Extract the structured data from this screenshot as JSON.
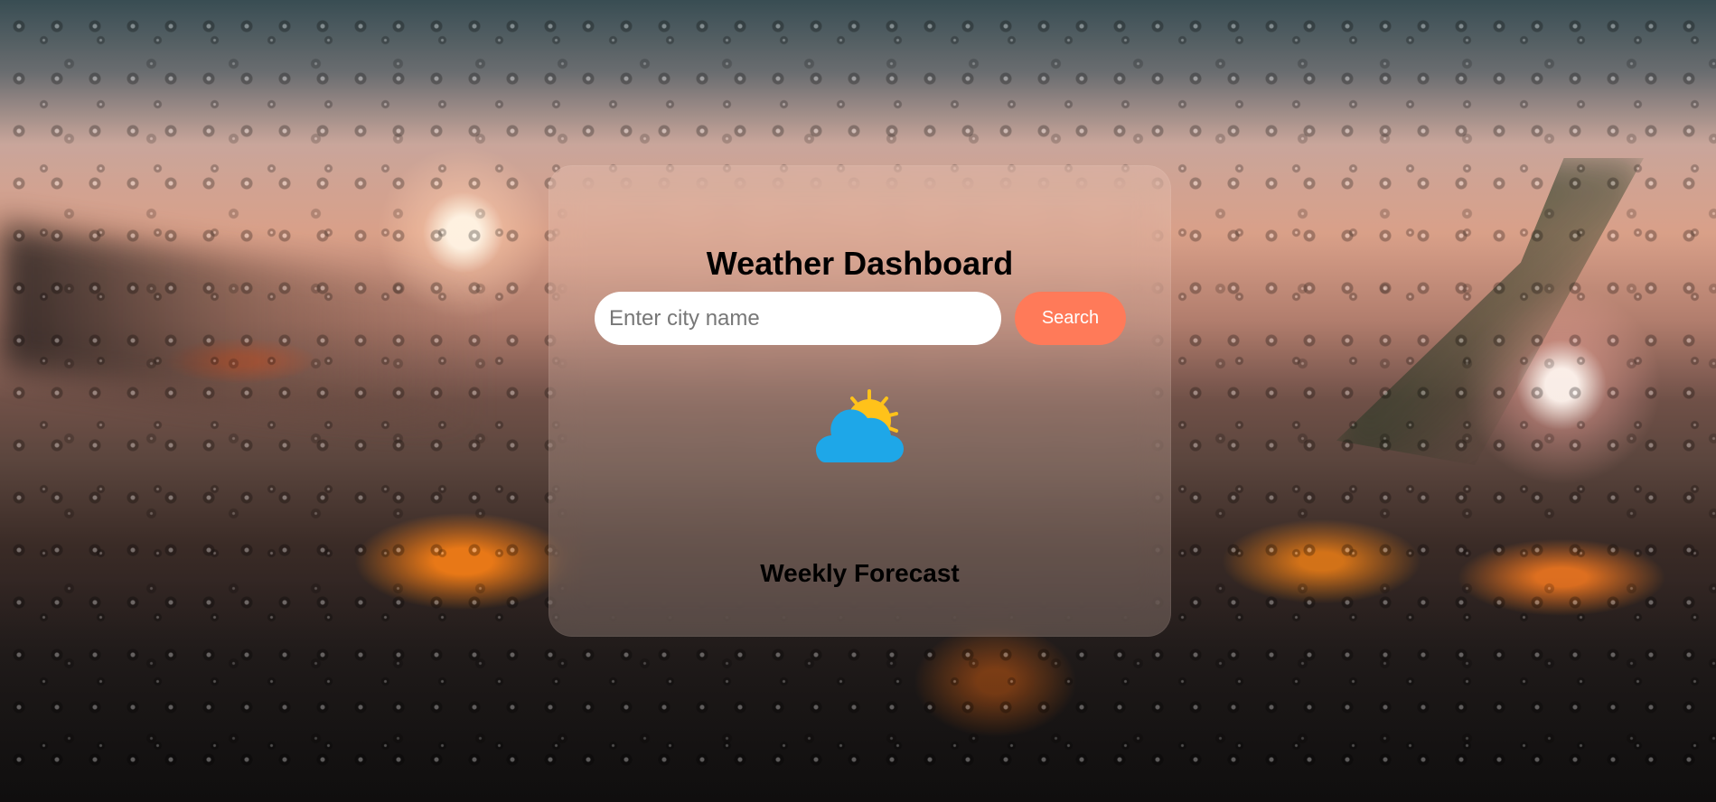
{
  "dashboard": {
    "title": "Weather Dashboard",
    "search": {
      "placeholder": "Enter city name",
      "value": "",
      "button_label": "Search"
    },
    "current_weather": {
      "icon": "partly-cloudy-icon"
    },
    "forecast": {
      "title": "Weekly Forecast",
      "items": []
    }
  },
  "colors": {
    "search_button": "#ff7a59",
    "search_input": "#ffffff",
    "title_text": "#000000",
    "sun": "#ffc21a",
    "cloud": "#1ea7e8"
  },
  "background": {
    "scene": "rain-covered-window-at-dusk"
  }
}
